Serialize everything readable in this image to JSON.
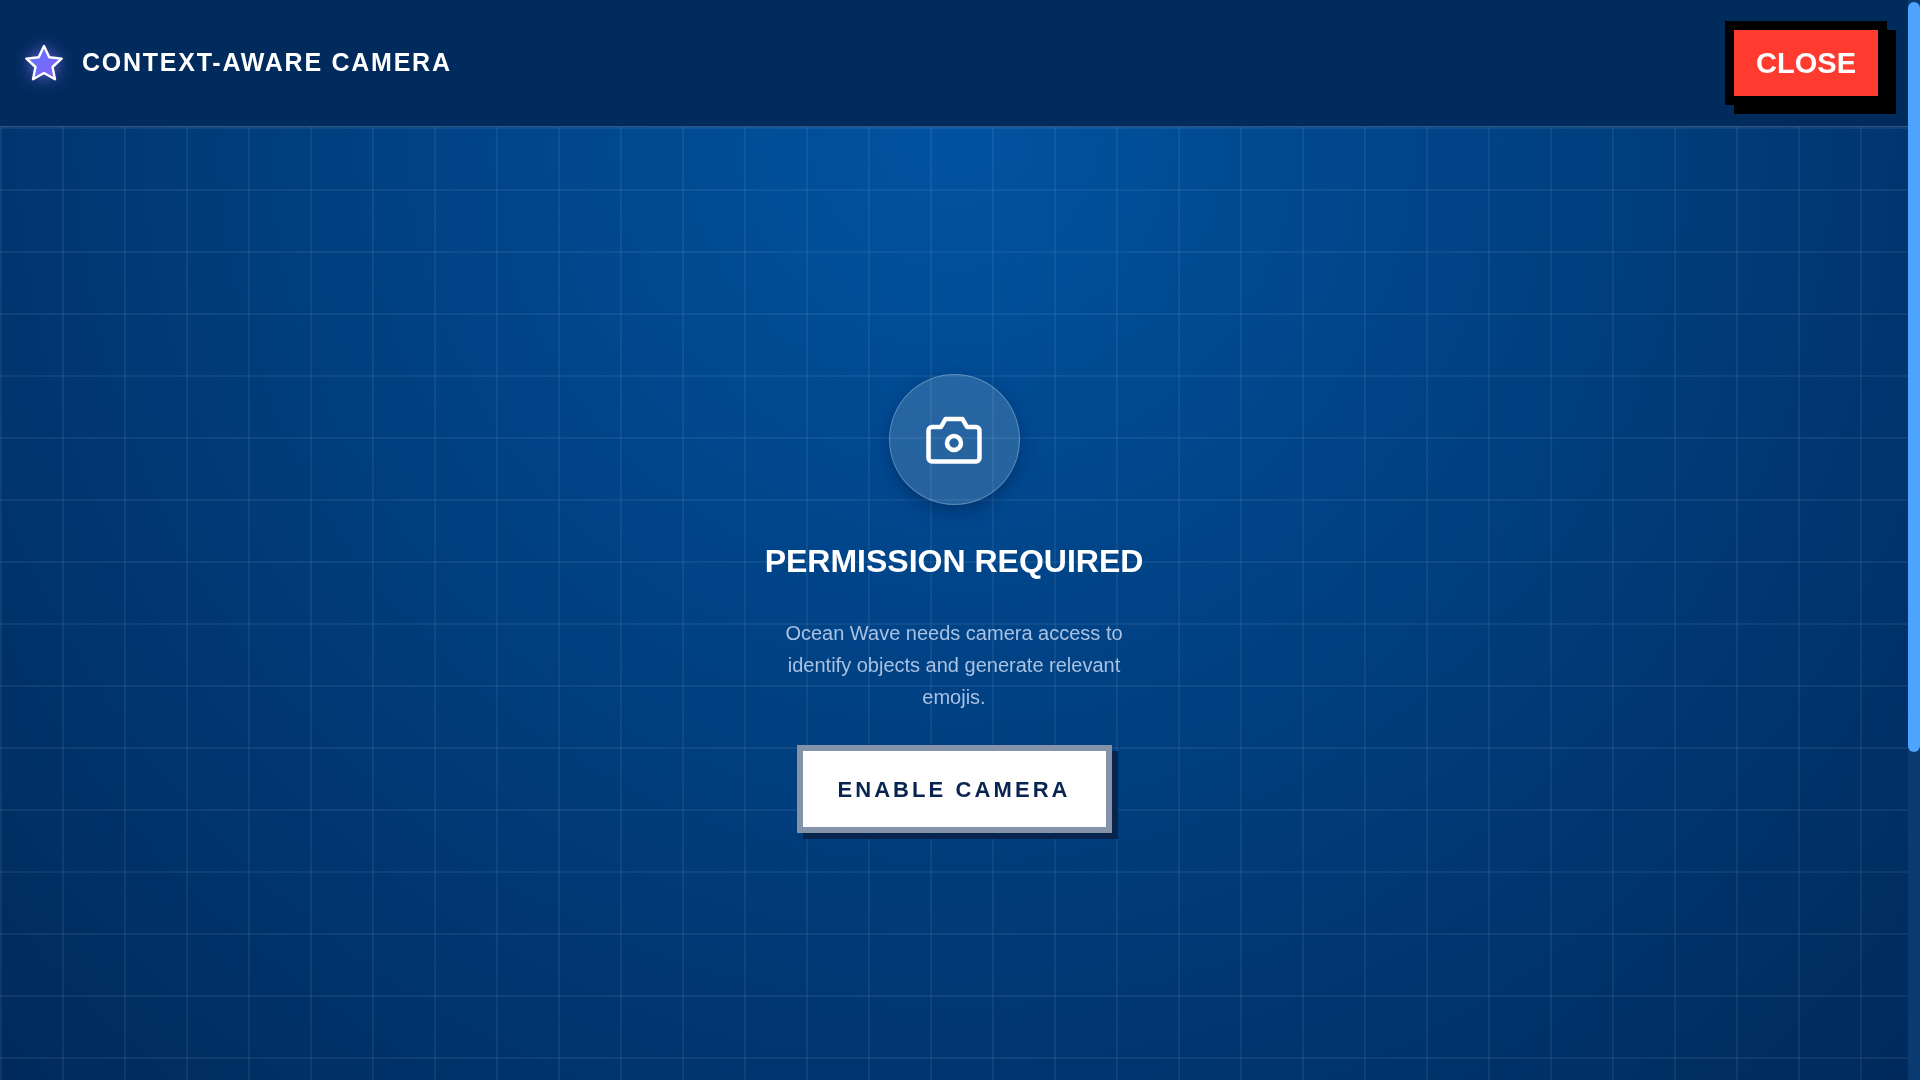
{
  "header": {
    "title": "CONTEXT-AWARE CAMERA",
    "close_button": "CLOSE"
  },
  "permission": {
    "title": "PERMISSION REQUIRED",
    "message": "Ocean Wave needs camera access to identify objects and generate relevant emojis.",
    "button": "ENABLE CAMERA"
  }
}
